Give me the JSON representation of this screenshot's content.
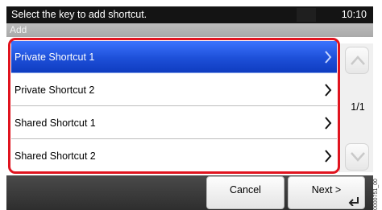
{
  "header": {
    "message": "Select the key to add shortcut.",
    "time": "10:10"
  },
  "subheader": {
    "title": "Add"
  },
  "list": {
    "items": [
      {
        "label": "Private Shortcut 1",
        "selected": true
      },
      {
        "label": "Private Shortcut 2",
        "selected": false
      },
      {
        "label": "Shared Shortcut 1",
        "selected": false
      },
      {
        "label": "Shared Shortcut 2",
        "selected": false
      }
    ]
  },
  "pager": {
    "indicator": "1/1"
  },
  "footer": {
    "cancel_label": "Cancel",
    "next_label": "Next >"
  },
  "side_code": "0000751_00",
  "colors": {
    "selected": "#1d4fd8",
    "highlight_frame": "#e0141f",
    "topbar": "#141414"
  }
}
